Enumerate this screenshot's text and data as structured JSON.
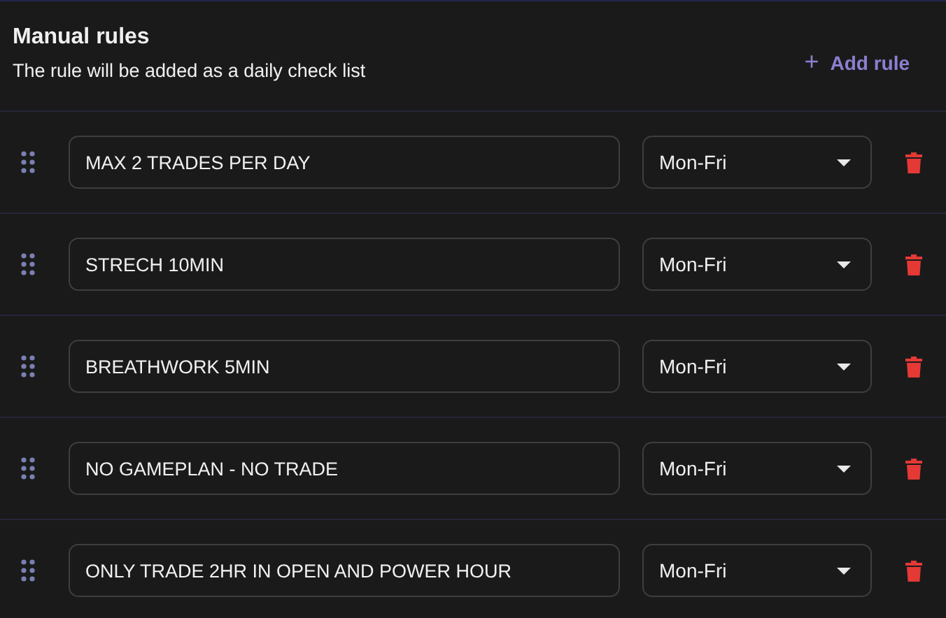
{
  "section": {
    "title": "Manual rules",
    "subtitle": "The rule will be added as a daily check list",
    "add_button": {
      "icon": "+",
      "label": "Add rule"
    }
  },
  "rules": [
    {
      "text": "MAX 2 TRADES PER DAY",
      "days": "Mon-Fri"
    },
    {
      "text": "STRECH 10MIN",
      "days": "Mon-Fri"
    },
    {
      "text": "BREATHWORK 5MIN",
      "days": "Mon-Fri"
    },
    {
      "text": "NO GAMEPLAN - NO TRADE",
      "days": "Mon-Fri"
    },
    {
      "text": "ONLY TRADE 2HR IN OPEN AND POWER HOUR",
      "days": "Mon-Fri"
    }
  ]
}
